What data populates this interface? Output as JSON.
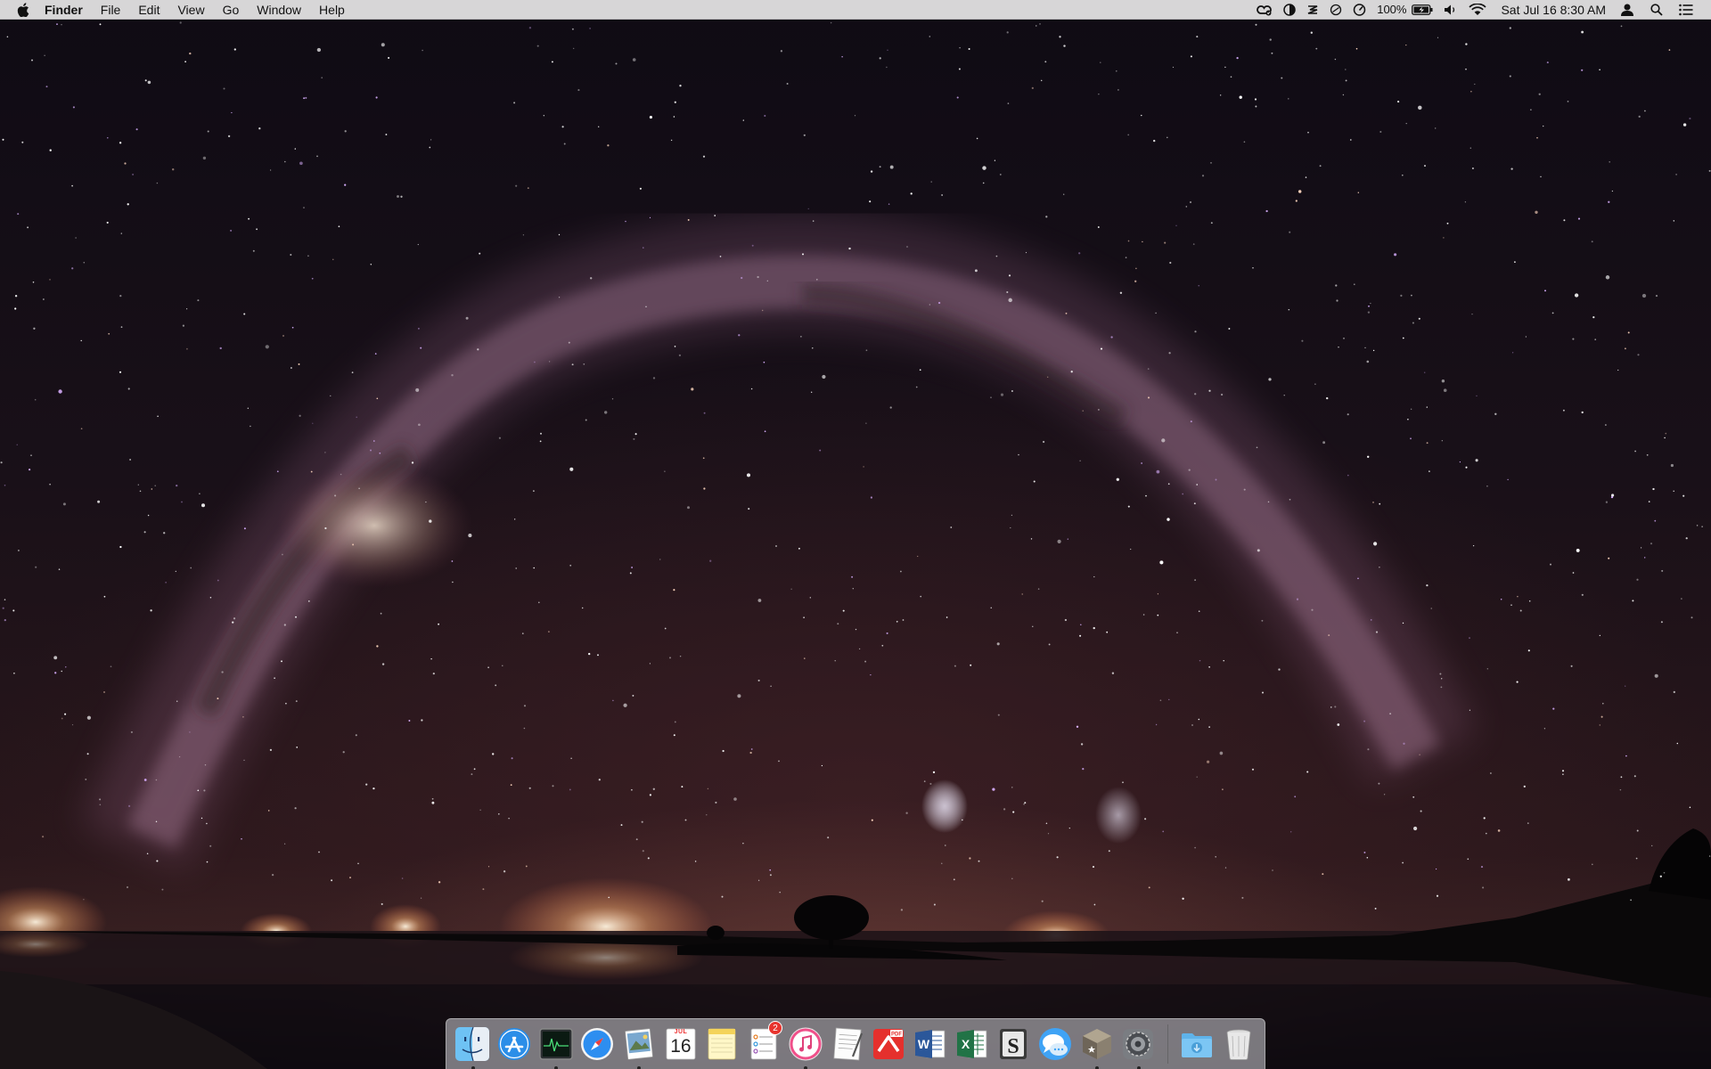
{
  "menubar": {
    "app_name": "Finder",
    "menus": [
      "File",
      "Edit",
      "View",
      "Go",
      "Window",
      "Help"
    ],
    "status": {
      "battery": "100%",
      "clock": "Sat Jul 16  8:30 AM",
      "icons": [
        "creative-cloud-icon",
        "contrast-icon",
        "stack-icon",
        "no-sync-icon",
        "speedometer-icon",
        "battery-icon",
        "volume-icon",
        "wifi-icon",
        "user-icon",
        "spotlight-icon",
        "notification-center-icon"
      ]
    }
  },
  "dock": {
    "apps": [
      {
        "name": "finder",
        "icon": "finder-icon",
        "running": true
      },
      {
        "name": "app-store",
        "icon": "app-store-icon",
        "running": false
      },
      {
        "name": "activity-monitor",
        "icon": "activity-monitor-icon",
        "running": true
      },
      {
        "name": "safari",
        "icon": "safari-icon",
        "running": false
      },
      {
        "name": "preview",
        "icon": "preview-icon",
        "running": true
      },
      {
        "name": "calendar",
        "icon": "calendar-icon",
        "running": false,
        "month": "JUL",
        "day": "16"
      },
      {
        "name": "notes",
        "icon": "notes-icon",
        "running": false
      },
      {
        "name": "reminders",
        "icon": "reminders-icon",
        "running": false,
        "badge": "2"
      },
      {
        "name": "itunes",
        "icon": "itunes-icon",
        "running": true
      },
      {
        "name": "textedit",
        "icon": "textedit-icon",
        "running": false
      },
      {
        "name": "pdf-expert",
        "icon": "pdf-icon",
        "running": false,
        "label": "PDF"
      },
      {
        "name": "microsoft-word",
        "icon": "word-icon",
        "running": false,
        "label": "W"
      },
      {
        "name": "microsoft-excel",
        "icon": "excel-icon",
        "running": false,
        "label": "X"
      },
      {
        "name": "scrivener",
        "icon": "scrivener-icon",
        "running": false,
        "label": "S"
      },
      {
        "name": "messages",
        "icon": "messages-icon",
        "running": false
      },
      {
        "name": "cube-app",
        "icon": "cube-icon",
        "running": true
      },
      {
        "name": "system-preferences",
        "icon": "system-preferences-icon",
        "running": true
      }
    ],
    "stacks": [
      {
        "name": "downloads",
        "icon": "downloads-folder-icon"
      },
      {
        "name": "trash",
        "icon": "trash-icon"
      }
    ]
  }
}
